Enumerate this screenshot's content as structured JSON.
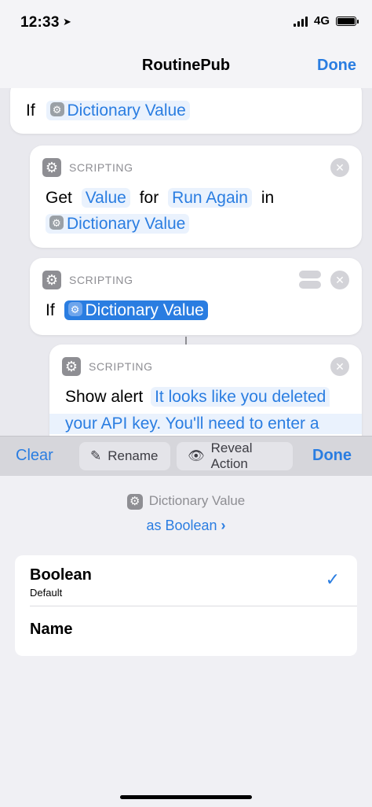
{
  "status": {
    "time": "12:33",
    "network": "4G"
  },
  "nav": {
    "title": "RoutinePub",
    "done": "Done"
  },
  "editor": {
    "block1": {
      "keyword": "If",
      "token": "Dictionary Value"
    },
    "block2": {
      "category": "SCRIPTING",
      "get": "Get",
      "value_token": "Value",
      "for": "for",
      "key_token": "Run Again",
      "in": "in",
      "dict_token": "Dictionary Value"
    },
    "block3": {
      "category": "SCRIPTING",
      "keyword": "If",
      "token": "Dictionary Value"
    },
    "block4": {
      "category": "SCRIPTING",
      "label": "Show alert",
      "text_line1": "It looks like you deleted",
      "text_line2": "your API key. You'll need to enter a"
    }
  },
  "keyboard_toolbar": {
    "clear": "Clear",
    "rename": "Rename",
    "reveal": "Reveal Action",
    "done": "Done"
  },
  "panel": {
    "variable": "Dictionary Value",
    "as_type": "as Boolean",
    "options": [
      {
        "label": "Boolean",
        "sub": "Default",
        "selected": true
      },
      {
        "label": "Name",
        "sub": "",
        "selected": false
      }
    ]
  },
  "colors": {
    "accent": "#2a7de1",
    "icon_gray": "#8e8e93"
  }
}
